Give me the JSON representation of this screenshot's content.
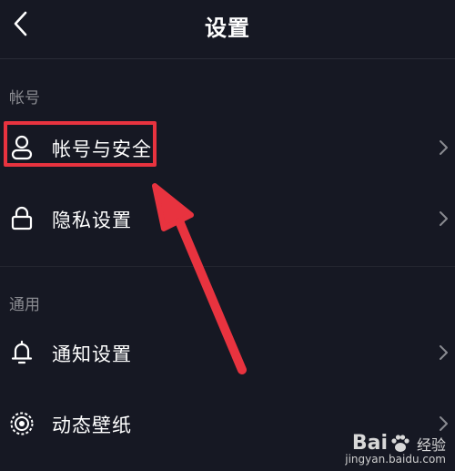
{
  "header": {
    "title": "设置"
  },
  "sections": [
    {
      "title": "帐号",
      "items": [
        {
          "label": "帐号与安全",
          "icon": "user-icon"
        },
        {
          "label": "隐私设置",
          "icon": "lock-icon"
        }
      ]
    },
    {
      "title": "通用",
      "items": [
        {
          "label": "通知设置",
          "icon": "bell-icon"
        },
        {
          "label": "动态壁纸",
          "icon": "wallpaper-icon"
        }
      ]
    }
  ],
  "watermark": {
    "brand_prefix": "Bai",
    "brand_suffix": "经验",
    "site": "jingyan.baidu.com"
  },
  "colors": {
    "background": "#161823",
    "highlight": "#e8333f",
    "secondary_text": "#8a8b91"
  }
}
